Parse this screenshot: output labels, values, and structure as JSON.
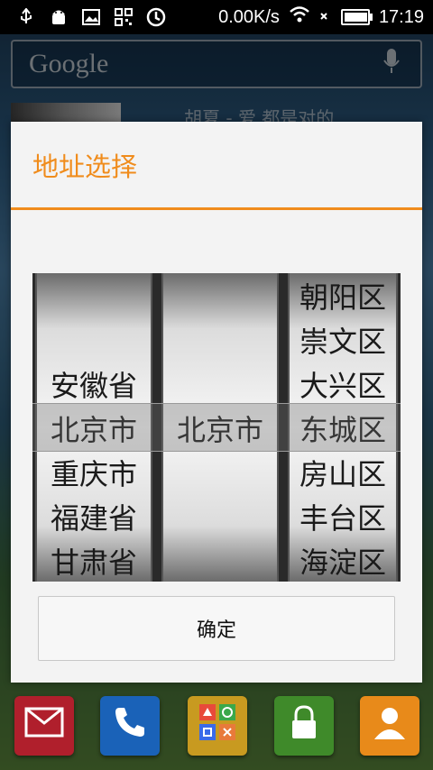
{
  "status_bar": {
    "network_speed": "0.00K/s",
    "time": "17:19",
    "battery_level": 0.9,
    "icons": [
      "usb-icon",
      "android-debug-icon",
      "image-icon",
      "qr-icon",
      "sync-icon",
      "wifi-icon",
      "signal-icon",
      "battery-icon"
    ]
  },
  "background": {
    "search_logo": "Google",
    "widget_text": "胡夏 - 爱 都是对的"
  },
  "dialog": {
    "title": "地址选择",
    "accent_color": "#f08c1c",
    "confirm_label": "确定",
    "picker": {
      "provinces": [
        "安徽省",
        "北京市",
        "重庆市",
        "福建省",
        "甘肃省"
      ],
      "cities": [
        "北京市"
      ],
      "districts": [
        "朝阳区",
        "崇文区",
        "大兴区",
        "东城区",
        "房山区",
        "丰台区",
        "海淀区"
      ],
      "selected": {
        "province": "北京市",
        "city": "北京市",
        "district": "东城区"
      }
    }
  },
  "dock": {
    "items": [
      {
        "name": "mail-app",
        "icon": "envelope-icon",
        "color": "#b01f2c"
      },
      {
        "name": "phone-app",
        "icon": "phone-icon",
        "color": "#1a62b8"
      },
      {
        "name": "games-app",
        "icon": "game-icon",
        "color": "#c89a20"
      },
      {
        "name": "lock-app",
        "icon": "lock-icon",
        "color": "#3f8a2a"
      },
      {
        "name": "contacts-app",
        "icon": "contact-icon",
        "color": "#e88a1a"
      }
    ]
  }
}
